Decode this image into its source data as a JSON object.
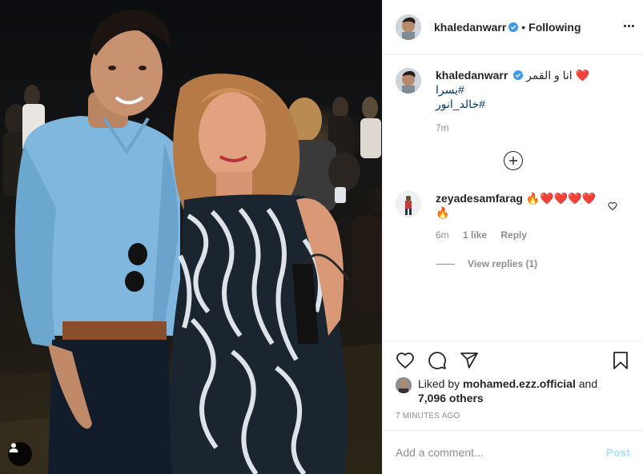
{
  "post": {
    "author": "khaledanwarr",
    "following_label": "Following",
    "separator": "•"
  },
  "caption": {
    "author": "khaledanwarr",
    "text": "انا و القمر ❤️",
    "hashtags": [
      "#يسرا",
      "#خالد_انور"
    ],
    "time": "7m"
  },
  "comments": [
    {
      "author": "zeyadesamfarag",
      "text": "🔥❤️❤️❤️❤️",
      "text2": "🔥",
      "time": "6m",
      "likes": "1 like",
      "reply_label": "Reply",
      "view_replies": "View replies (1)"
    }
  ],
  "likes": {
    "prefix": "Liked by",
    "user": "mohamed.ezz.official",
    "and": "and",
    "others": "7,096 others"
  },
  "timestamp": "7 MINUTES AGO",
  "add_comment": {
    "placeholder": "Add a comment...",
    "post_label": "Post"
  },
  "icons": {
    "verified": "verified-badge-icon",
    "more": "more-options-icon",
    "add": "load-more-comments-icon",
    "like": "heart-icon",
    "comment": "comment-icon",
    "share": "share-icon",
    "save": "bookmark-icon",
    "user_tag": "user-tag-icon"
  },
  "colors": {
    "verified_blue": "#3897f0",
    "link_blue": "#00376b",
    "post_disabled": "#b2dffc",
    "muted": "#8e8e8e"
  }
}
